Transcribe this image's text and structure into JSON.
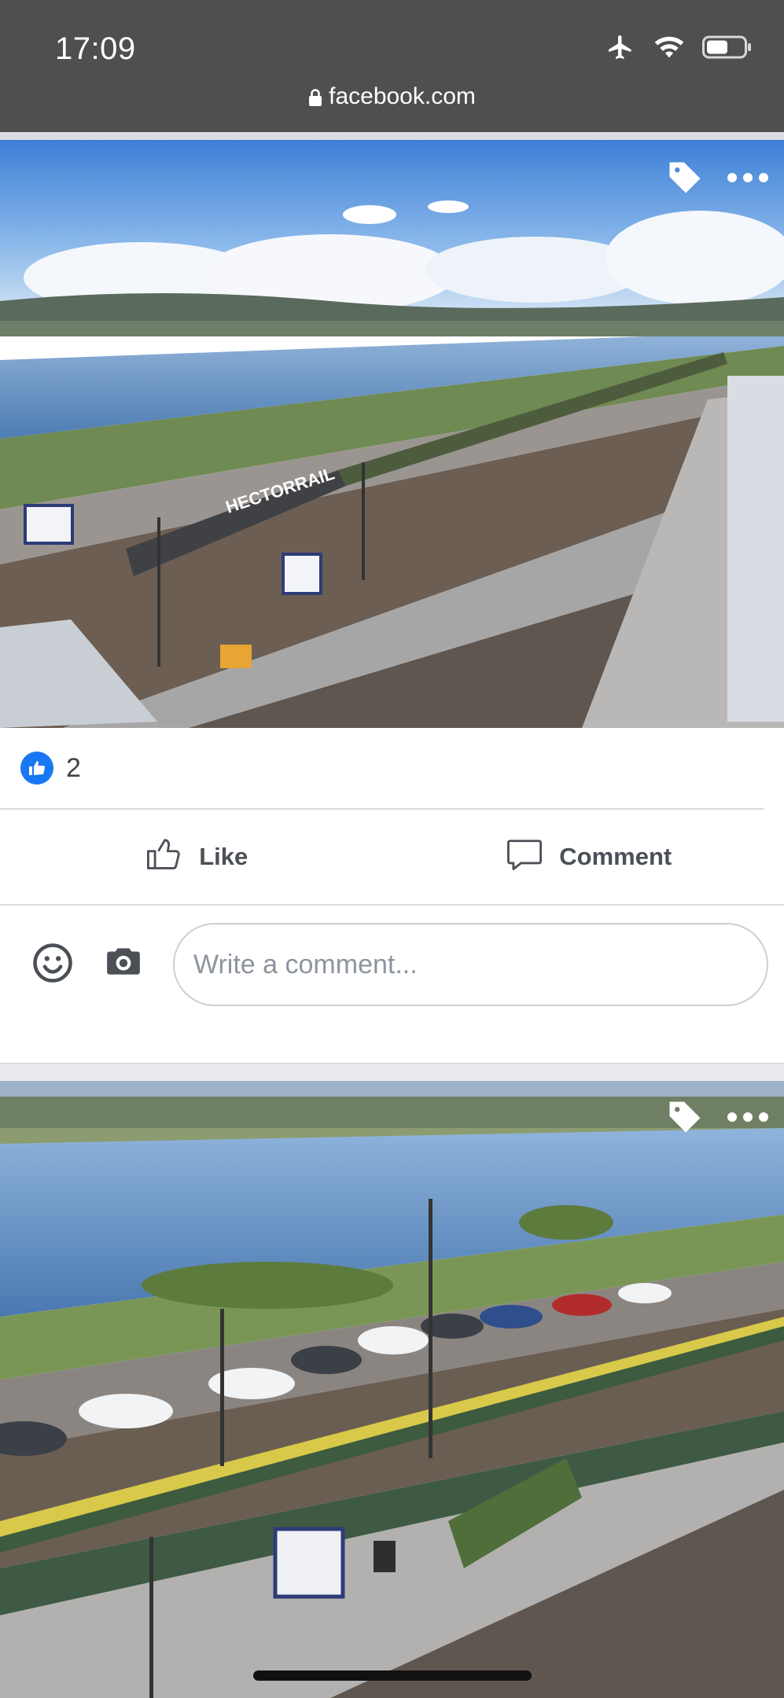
{
  "status_bar": {
    "time": "17:09",
    "icons": [
      "airplane-icon",
      "wifi-icon",
      "battery-icon"
    ]
  },
  "browser": {
    "url": "facebook.com"
  },
  "posts": [
    {
      "photo_alt": "Hector Rail car-carrier train at a station by a river",
      "overlay_icons": [
        "tag-icon",
        "more-icon"
      ],
      "reactions": {
        "icon": "like-reaction-icon",
        "count": "2"
      },
      "actions": {
        "like_label": "Like",
        "comment_label": "Comment"
      },
      "composer": {
        "placeholder": "Write a comment..."
      }
    },
    {
      "photo_alt": "Train carrying cars along a river station",
      "overlay_icons": [
        "tag-icon",
        "more-icon"
      ]
    }
  ],
  "colors": {
    "accent": "#1877f2",
    "status_bar": "#4f4f4f"
  }
}
